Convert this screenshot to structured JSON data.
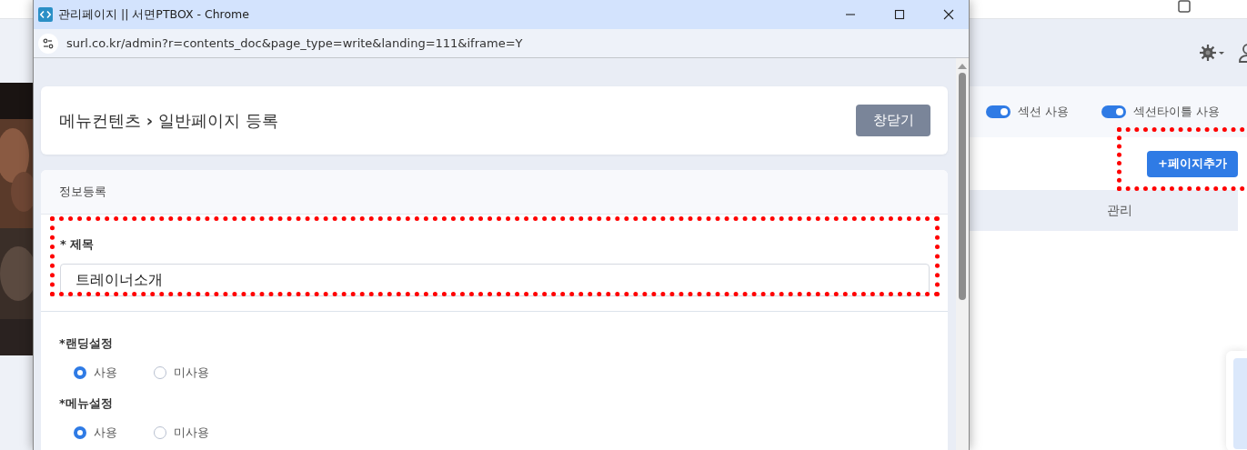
{
  "background_page": {
    "toggles": [
      {
        "label": "섹션 사용",
        "on": true
      },
      {
        "label": "섹션타이틀 사용",
        "on": true
      }
    ],
    "add_page_button": "+페이지추가",
    "table": {
      "columns": [
        "관리"
      ]
    }
  },
  "popup": {
    "title": "관리페이지 || 서면PTBOX - Chrome",
    "url": "surl.co.kr/admin?r=contents_doc&page_type=write&landing=111&iframe=Y",
    "breadcrumb": [
      "메뉴컨텐츠",
      "일반페이지 등록"
    ],
    "breadcrumb_separator": "›",
    "close_button": "창닫기",
    "section_title": "정보등록",
    "title_field": {
      "label": "* 제목",
      "value": "트레이너소개"
    },
    "radio_groups": [
      {
        "label": "*랜딩설정",
        "options": [
          {
            "label": "사용",
            "selected": true
          },
          {
            "label": "미사용",
            "selected": false
          }
        ]
      },
      {
        "label": "*메뉴설정",
        "options": [
          {
            "label": "사용",
            "selected": true
          },
          {
            "label": "미사용",
            "selected": false
          }
        ]
      }
    ]
  }
}
